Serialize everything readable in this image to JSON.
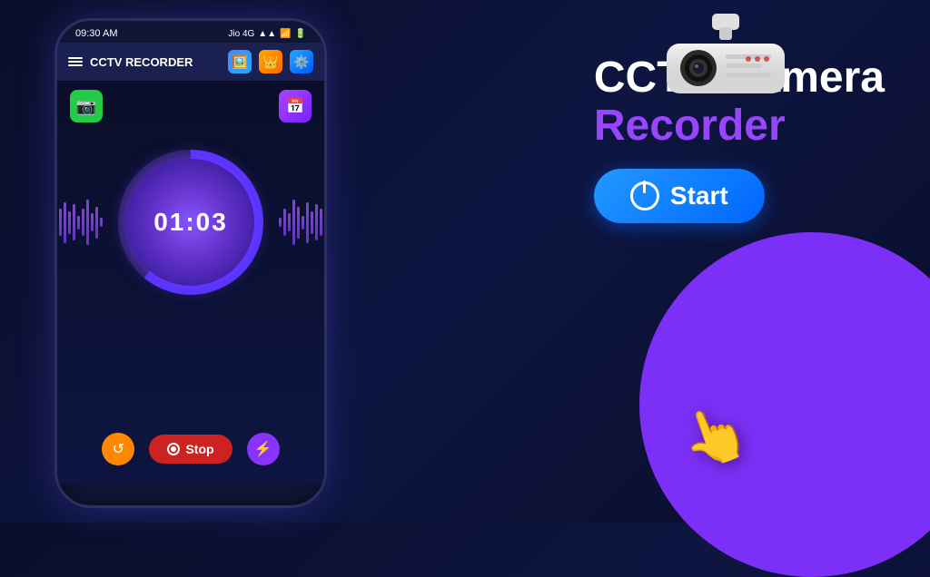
{
  "app": {
    "title": "CCTV RECORDER",
    "status_bar": {
      "time": "09:30 AM",
      "carrier": "Jio 4G"
    }
  },
  "header": {
    "title": "CCTV RECORDER",
    "icons": [
      "🖼️",
      "👑",
      "⚙️"
    ]
  },
  "phone": {
    "top_buttons": {
      "left_icon": "📷",
      "right_icon": "📅"
    },
    "timer": {
      "value": "01:03"
    },
    "controls": {
      "rotate_label": "↺",
      "stop_label": "Stop",
      "lightning_label": "⚡"
    }
  },
  "marketing": {
    "title_line1": "CCTV Camera",
    "title_line2": "Recorder",
    "start_button_label": "Start"
  },
  "colors": {
    "accent_purple": "#9944ff",
    "accent_blue": "#2299ff",
    "stop_red": "#cc2222",
    "bg_dark": "#0a0e2a"
  }
}
